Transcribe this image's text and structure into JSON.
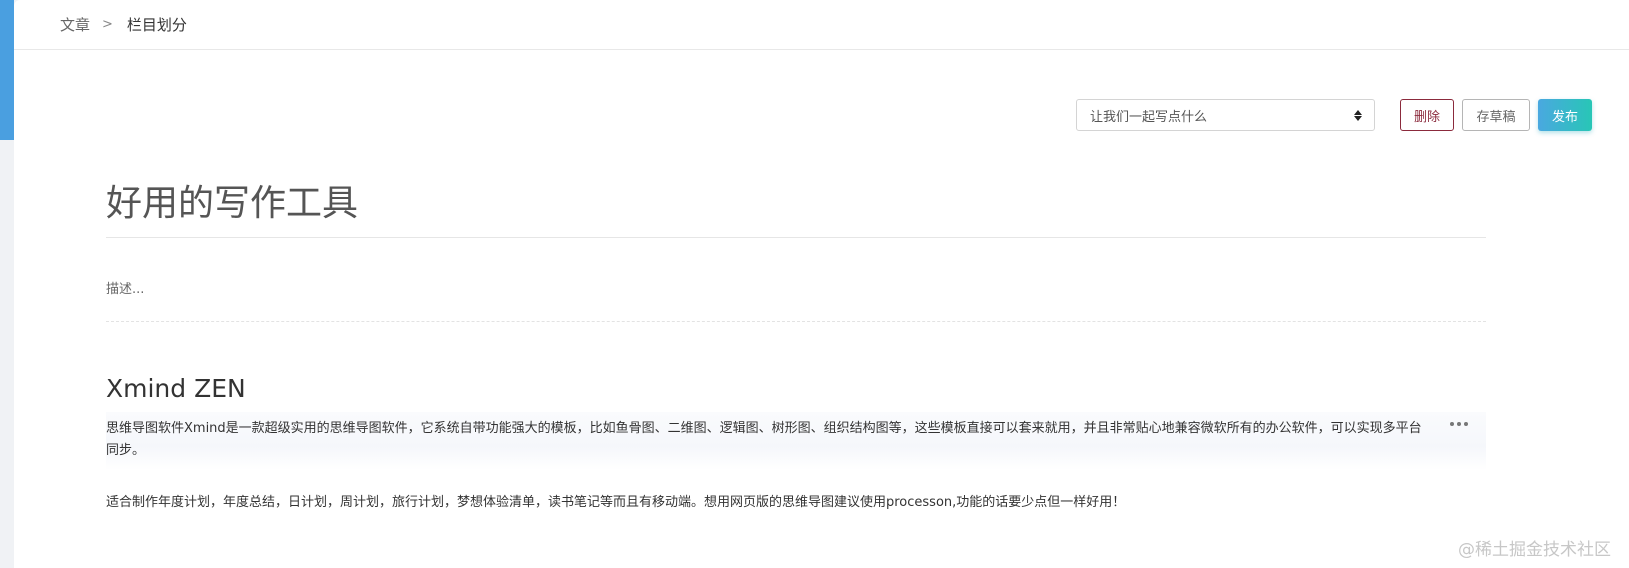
{
  "breadcrumb": {
    "parent": "文章",
    "separator": ">",
    "current": "栏目划分"
  },
  "toolbar": {
    "category_select": {
      "selected": "让我们一起写点什么"
    },
    "delete_label": "删除",
    "draft_label": "存草稿",
    "publish_label": "发布"
  },
  "editor": {
    "title": "好用的写作工具",
    "description_placeholder": "描述...",
    "content": {
      "heading": "Xmind ZEN",
      "paragraphs": [
        "思维导图软件Xmind是一款超级实用的思维导图软件，它系统自带功能强大的模板，比如鱼骨图、二维图、逻辑图、树形图、组织结构图等，这些模板直接可以套来就用，并且非常贴心地兼容微软所有的办公软件，可以实现多平台同步。",
        "适合制作年度计划，年度总结，日计划，周计划，旅行计划，梦想体验清单，读书笔记等而且有移动端。想用网页版的思维导图建议使用processon,功能的话要少点但一样好用！"
      ]
    }
  },
  "watermark": "@稀土掘金技术社区",
  "icons": {
    "more": "more-horizontal-icon",
    "select": "select-arrows-icon"
  },
  "colors": {
    "accent_blue": "#4a9fe0",
    "delete": "#8b2a3c",
    "publish_gradient_start": "#4aa8e0",
    "publish_gradient_end": "#28c6b6"
  }
}
